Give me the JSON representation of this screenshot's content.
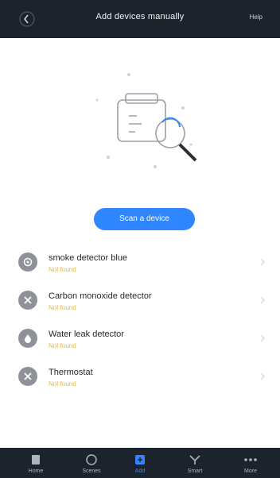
{
  "header": {
    "title": "Add devices manually",
    "right_label": "Help",
    "back_icon": "back-arrow-icon"
  },
  "main": {
    "scan_button_label": "Scan a device",
    "illustration": "search-devices-illustration"
  },
  "devices": [
    {
      "name": "smoke detector blue",
      "status": "Not found",
      "icon": "smoke-detector-icon"
    },
    {
      "name": "Carbon monoxide detector",
      "status": "Not found",
      "icon": "close-icon"
    },
    {
      "name": "Water leak detector",
      "status": "Not found",
      "icon": "water-drop-icon"
    },
    {
      "name": "Thermostat",
      "status": "Not found",
      "icon": "close-icon"
    }
  ],
  "bottom_nav": [
    {
      "label": "Home",
      "icon": "home-icon",
      "active": false
    },
    {
      "label": "Scenes",
      "icon": "scenes-icon",
      "active": false
    },
    {
      "label": "Add",
      "icon": "add-icon",
      "active": true
    },
    {
      "label": "Smart",
      "icon": "smart-icon",
      "active": false
    },
    {
      "label": "More",
      "icon": "more-icon",
      "active": false
    }
  ],
  "colors": {
    "bar": "#1d232c",
    "accent": "#2f86ff",
    "status": "#e6b84b",
    "icon_bg": "#8e9298"
  }
}
